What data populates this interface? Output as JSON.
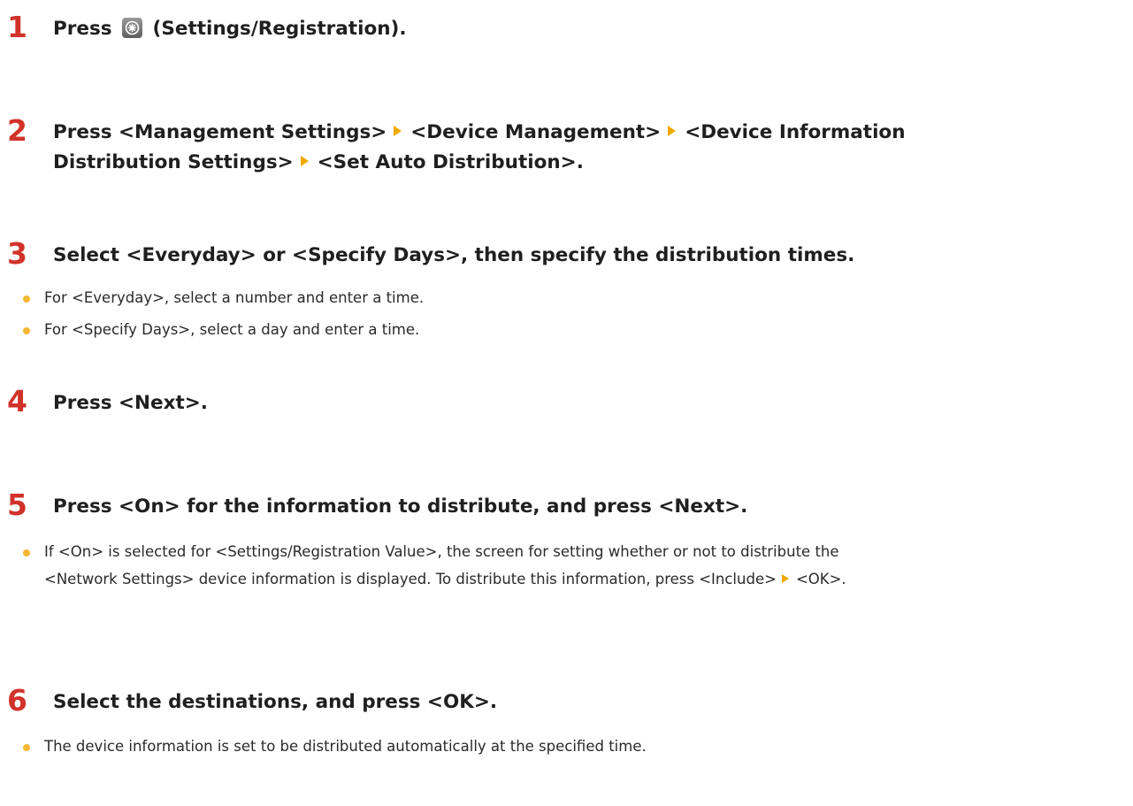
{
  "steps": [
    {
      "number": "1",
      "text_before": "Press",
      "icon": "settings-registration-icon",
      "text_after": "(Settings/Registration)."
    },
    {
      "number": "2",
      "parts": [
        "Press <Management Settings>",
        "<Device Management>",
        "<Device Information",
        "Distribution Settings>",
        "<Set Auto Distribution>."
      ]
    },
    {
      "number": "3",
      "text": "Select <Everyday> or <Specify Days>, then specify the distribution times.",
      "bullets": [
        "For <Everyday>, select a number and enter a time.",
        "For <Specify Days>, select a day and enter a time."
      ]
    },
    {
      "number": "4",
      "text": "Press <Next>."
    },
    {
      "number": "5",
      "text": "Press <On> for the information to distribute, and press <Next>.",
      "bullet_line1": "If <On> is selected for <Settings/Registration Value>, the screen for setting whether or not to distribute the",
      "bullet_line2a": "<Network Settings> device information is displayed. To distribute this information, press <Include>",
      "bullet_line2b": "<OK>."
    },
    {
      "number": "6",
      "text": "Select the destinations, and press <OK>.",
      "bullets": [
        "The device information is set to be distributed automatically at the specified time."
      ]
    }
  ],
  "colors": {
    "step_number": "#d1322a",
    "arrow": "#f0a800",
    "bullet": "#f5b733"
  }
}
